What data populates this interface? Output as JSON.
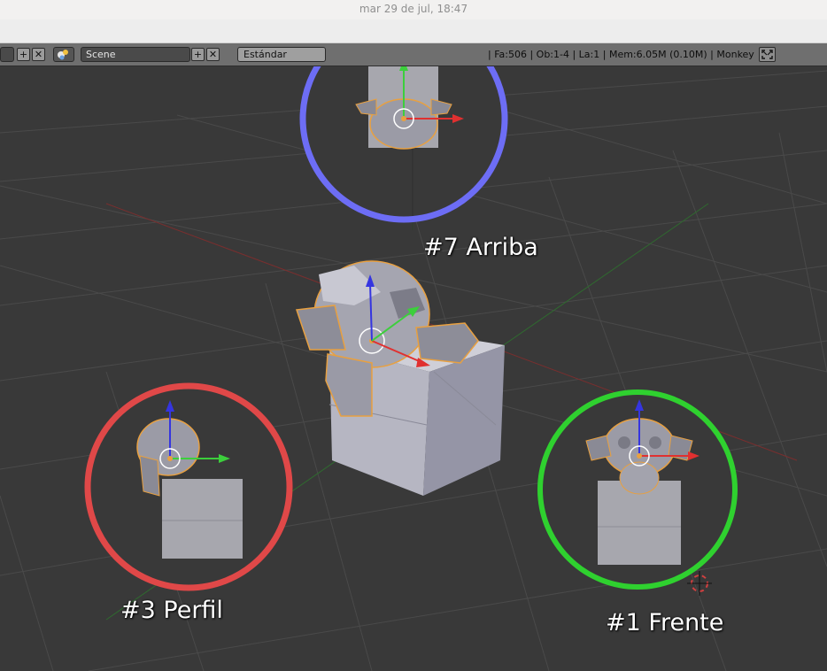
{
  "system_bar": {
    "clock": "mar 29 de jul, 18:47"
  },
  "header": {
    "scene_name": "Scene",
    "screen_layout": "Estándar",
    "stats": "| Fa:506 | Ob:1-4 | La:1 | Mem:6.05M (0.10M) | Monkey",
    "add_glyph": "+",
    "close_glyph": "✕"
  },
  "icons": [
    "scene-icon",
    "add-icon",
    "close-icon",
    "fullscreen-icon",
    "3d-cursor-icon"
  ],
  "colors": {
    "viewport_bg": "#393939",
    "top_view_ring": "#6d6df5",
    "side_view_ring": "#e04848",
    "front_view_ring": "#2fd12f",
    "axis_x": "#e03030",
    "axis_y": "#3ccf3c",
    "axis_z": "#3535e0",
    "selection_outline": "#e8a040"
  },
  "annotations": {
    "top": "#7 Arriba",
    "side": "#3 Perfil",
    "front": "#1 Frente"
  }
}
